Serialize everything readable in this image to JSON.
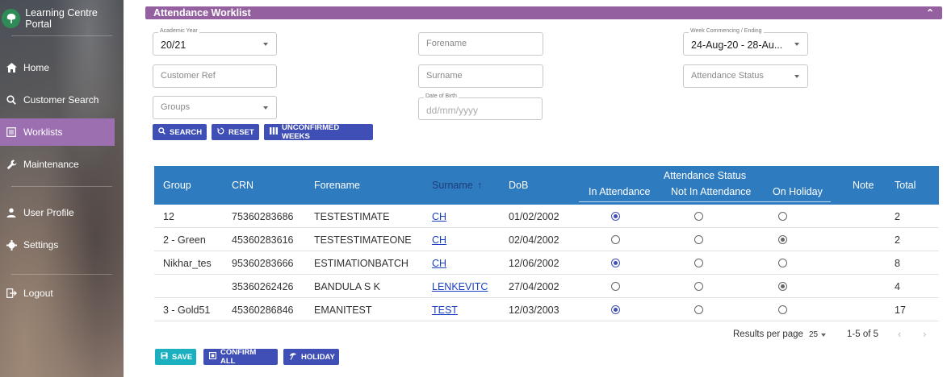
{
  "app": {
    "title": "Learning Centre Portal"
  },
  "sidebar": {
    "items": [
      {
        "label": "Home",
        "icon": "home-icon"
      },
      {
        "label": "Customer Search",
        "icon": "search-icon"
      },
      {
        "label": "Worklists",
        "icon": "list-icon",
        "active": true
      },
      {
        "label": "Maintenance",
        "icon": "wrench-icon"
      },
      {
        "label": "User Profile",
        "icon": "person-icon"
      },
      {
        "label": "Settings",
        "icon": "gear-icon"
      },
      {
        "label": "Logout",
        "icon": "logout-icon"
      }
    ]
  },
  "panel": {
    "title": "Attendance Worklist"
  },
  "filters": {
    "academic_year": {
      "label": "Academic Year",
      "value": "20/21"
    },
    "forename": {
      "placeholder": "Forename"
    },
    "week": {
      "label": "Week Commencing / Ending",
      "value": "24-Aug-20 - 28-Au..."
    },
    "customer_ref": {
      "placeholder": "Customer Ref"
    },
    "surname": {
      "placeholder": "Surname"
    },
    "attendance_status": {
      "placeholder": "Attendance Status"
    },
    "groups": {
      "placeholder": "Groups"
    },
    "dob": {
      "label": "Date of Birth",
      "placeholder": "dd/mm/yyyy"
    }
  },
  "actions": {
    "search": "SEARCH",
    "reset": "RESET",
    "unconfirmed": "UNCONFIRMED WEEKS",
    "save": "SAVE",
    "confirm_all": "CONFIRM ALL",
    "holiday": "HOLIDAY"
  },
  "table": {
    "headers": {
      "group": "Group",
      "crn": "CRN",
      "forename": "Forename",
      "surname": "Surname",
      "sort_arrow": "↑",
      "dob": "DoB",
      "attendance_status": "Attendance Status",
      "in_attendance": "In Attendance",
      "not_in_attendance": "Not In Attendance",
      "on_holiday": "On Holiday",
      "note": "Note",
      "total": "Total"
    },
    "rows": [
      {
        "group": "12",
        "crn": "75360283686",
        "forename": "TESTESTIMATE",
        "surname": "CH",
        "dob": "01/02/2002",
        "status": "in",
        "total": "2"
      },
      {
        "group": "2 - Green",
        "crn": "45360283616",
        "forename": "TESTESTIMATEONE",
        "surname": "CH",
        "dob": "02/04/2002",
        "status": "holiday",
        "total": "2"
      },
      {
        "group": "Nikhar_tes",
        "crn": "95360283666",
        "forename": "ESTIMATIONBATCH",
        "surname": "CH",
        "dob": "12/06/2002",
        "status": "in",
        "total": "8"
      },
      {
        "group": "",
        "crn": "35360262426",
        "forename": "BANDULA S K",
        "surname": "LENKEVITC",
        "dob": "27/04/2002",
        "status": "holiday",
        "total": "4"
      },
      {
        "group": "3 - Gold51",
        "crn": "45360286846",
        "forename": "EMANITEST",
        "surname": "TEST",
        "dob": "12/03/2003",
        "status": "in",
        "total": "17"
      }
    ]
  },
  "pagination": {
    "rows_label": "Results per page",
    "rows_value": "25",
    "range": "1-5 of 5"
  },
  "colors": {
    "accent_purple": "#94609f",
    "sidebar_active": "#9b6fb0",
    "table_header": "#2f7bbf",
    "button_blue": "#3f4fb5",
    "button_teal": "#1ab0c0"
  }
}
